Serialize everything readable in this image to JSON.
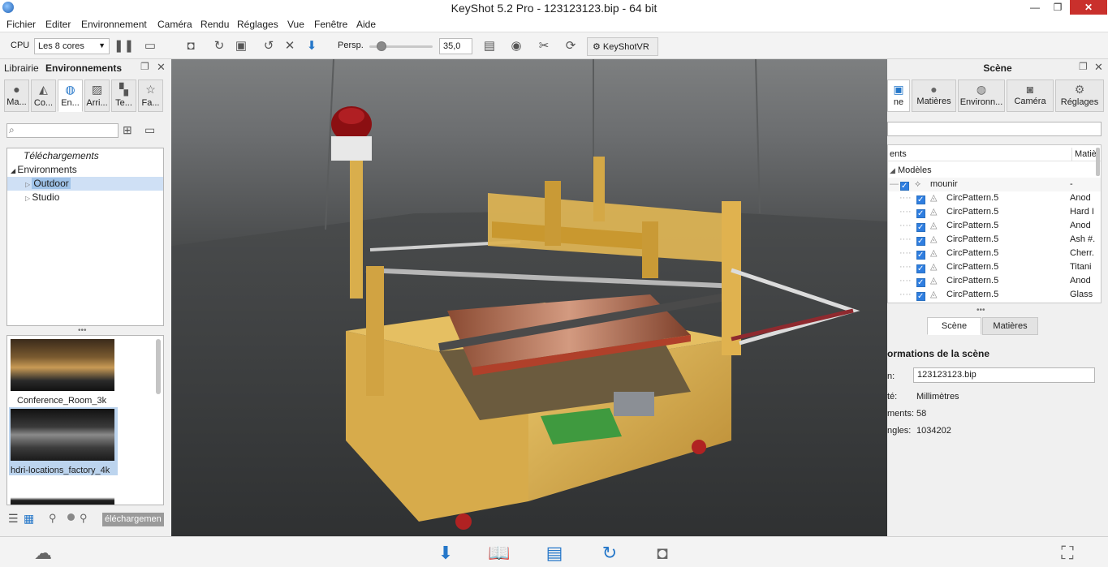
{
  "window": {
    "title": "KeyShot 5.2 Pro  -  123123123.bip  -  64 bit",
    "minimize": "—",
    "restore": "❐",
    "close": "✕"
  },
  "menu": [
    "Fichier",
    "Editer",
    "Environnement",
    "Caméra",
    "Rendu",
    "Réglages",
    "Vue",
    "Fenêtre",
    "Aide"
  ],
  "toolbar": {
    "cpu_label": "CPU",
    "cores_value": "Les 8 cores",
    "persp_label": "Persp.",
    "fov_value": "35,0",
    "vr_label": "KeyShotVR"
  },
  "library": {
    "tab_librairie": "Librairie",
    "tab_environnements": "Environnements",
    "tabs": [
      "Ma...",
      "Co...",
      "En...",
      "Arri...",
      "Te...",
      "Fa..."
    ],
    "tree": {
      "downloads": "Téléchargements",
      "environments": "Environments",
      "outdoor": "Outdoor",
      "studio": "Studio"
    },
    "thumbs": [
      "Conference_Room_3k",
      "hdri-locations_factory_4k"
    ],
    "download_button": "éléchargemen"
  },
  "scene": {
    "panel_title": "Scène",
    "tabs": [
      "ne",
      "Matières",
      "Environn...",
      "Caméra",
      "Réglages"
    ],
    "col_left": "ents",
    "col_right": "Matiè",
    "models_label": "Modèles",
    "root_label": "mounir",
    "root_value": "-",
    "rows": [
      {
        "name": "CircPattern.5",
        "mat": "Anod"
      },
      {
        "name": "CircPattern.5",
        "mat": "Hard I"
      },
      {
        "name": "CircPattern.5",
        "mat": "Anod"
      },
      {
        "name": "CircPattern.5",
        "mat": "Ash #."
      },
      {
        "name": "CircPattern.5",
        "mat": "Cherr."
      },
      {
        "name": "CircPattern.5",
        "mat": "Titani"
      },
      {
        "name": "CircPattern.5",
        "mat": "Anod"
      },
      {
        "name": "CircPattern.5",
        "mat": "Glass"
      }
    ],
    "subtab_scene": "Scène",
    "subtab_materials": "Matières",
    "info_title": "ormations de la scène",
    "name_label": "n:",
    "name_value": "123123123.bip",
    "unit_label": "té:",
    "unit_value": "Millimètres",
    "parts_label": "ments:",
    "parts_value": "58",
    "tri_label": "ngles:",
    "tri_value": "1034202"
  }
}
